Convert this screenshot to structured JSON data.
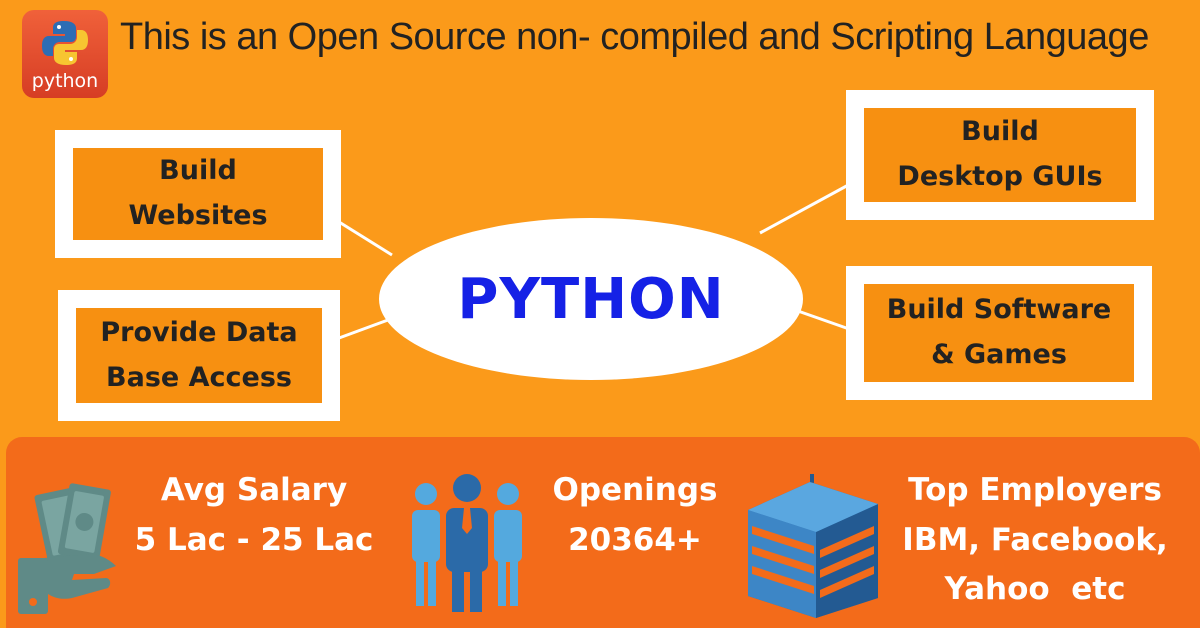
{
  "header": {
    "logo_text": "python",
    "title": "This is an Open Source non- compiled and Scripting Language"
  },
  "center": {
    "label": "PYTHON"
  },
  "boxes": {
    "top_left": {
      "line1": "Build",
      "line2": "Websites"
    },
    "bottom_left": {
      "line1": "Provide Data",
      "line2": "Base Access"
    },
    "top_right": {
      "line1": "Build",
      "line2": "Desktop GUIs"
    },
    "bottom_right": {
      "line1": "Build Software",
      "line2": "& Games"
    }
  },
  "stats": {
    "salary": {
      "line1": "Avg Salary",
      "line2": "5 Lac - 25 Lac",
      "icon": "money-hand-icon"
    },
    "openings": {
      "line1": "Openings",
      "line2": "20364+",
      "icon": "people-icon"
    },
    "employers": {
      "line1": "Top Employers",
      "line2": "IBM, Facebook,",
      "line3": "Yahoo  etc",
      "icon": "building-icon"
    }
  },
  "colors": {
    "background": "#fb9a1a",
    "box_fill": "#f79011",
    "bottom_band": "#f36b1a",
    "center_text": "#1521e6",
    "icon_blue": "#2b6aa8",
    "icon_light_blue": "#54a9de"
  }
}
